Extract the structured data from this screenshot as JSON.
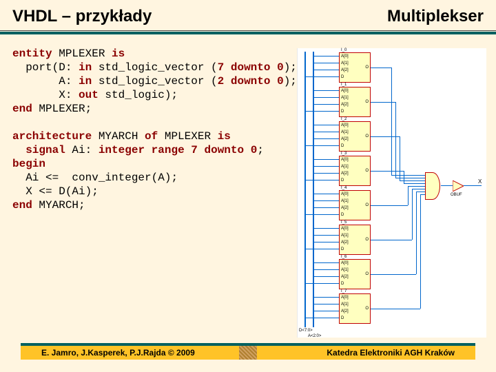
{
  "header": {
    "title_left": "VHDL – przykłady",
    "title_right": "Multiplekser"
  },
  "code": {
    "kw_entity": "entity",
    "t1": " MPLEXER ",
    "kw_is1": "is",
    "t2": "\n  port(D: ",
    "kw_in1": "in",
    "t3": " std_logic_vector (",
    "kw_7": "7",
    "t4": " ",
    "kw_downto1": "downto",
    "t5": " ",
    "kw_0a": "0",
    "t6": ");\n       A: ",
    "kw_in2": "in",
    "t7": " std_logic_vector (",
    "kw_2": "2",
    "t8": " ",
    "kw_downto2": "downto",
    "t9": " ",
    "kw_0b": "0",
    "t10": ");\n       X: ",
    "kw_out": "out",
    "t11": " std_logic);\n",
    "kw_end1": "end",
    "t12": " MPLEXER;",
    "blank1": "\n\n",
    "kw_arch": "architecture",
    "t13": " MYARCH ",
    "kw_of": "of",
    "t14": " MPLEXER ",
    "kw_is2": "is",
    "t15": "\n  ",
    "kw_signal": "signal",
    "t16": " Ai: ",
    "kw_integer": "integer",
    "t17": " ",
    "kw_range": "range",
    "t18": " ",
    "kw_7b": "7",
    "t19": " ",
    "kw_downto3": "downto",
    "t20": " ",
    "kw_0c": "0",
    "t21": ";\n",
    "kw_begin": "begin",
    "t22": "\n  Ai <=  conv_integer(A);\n  X <= D(Ai);\n",
    "kw_end2": "end",
    "t23": " MYARCH;"
  },
  "diagram": {
    "block_labels": [
      "I_0",
      "I_1",
      "I_2",
      "I_3",
      "I_4",
      "I_5",
      "I_6",
      "I_7"
    ],
    "port_labels": [
      "A[0]",
      "A[1]",
      "A[2]",
      "D",
      "O"
    ],
    "input_labels": [
      "D<7:0>",
      "A<2:0>"
    ],
    "buf_label": "OBUF",
    "output_label": "X"
  },
  "footer": {
    "left": "E. Jamro, J.Kasperek, P.J.Rajda © 2009",
    "right": "Katedra Elektroniki AGH Kraków"
  }
}
